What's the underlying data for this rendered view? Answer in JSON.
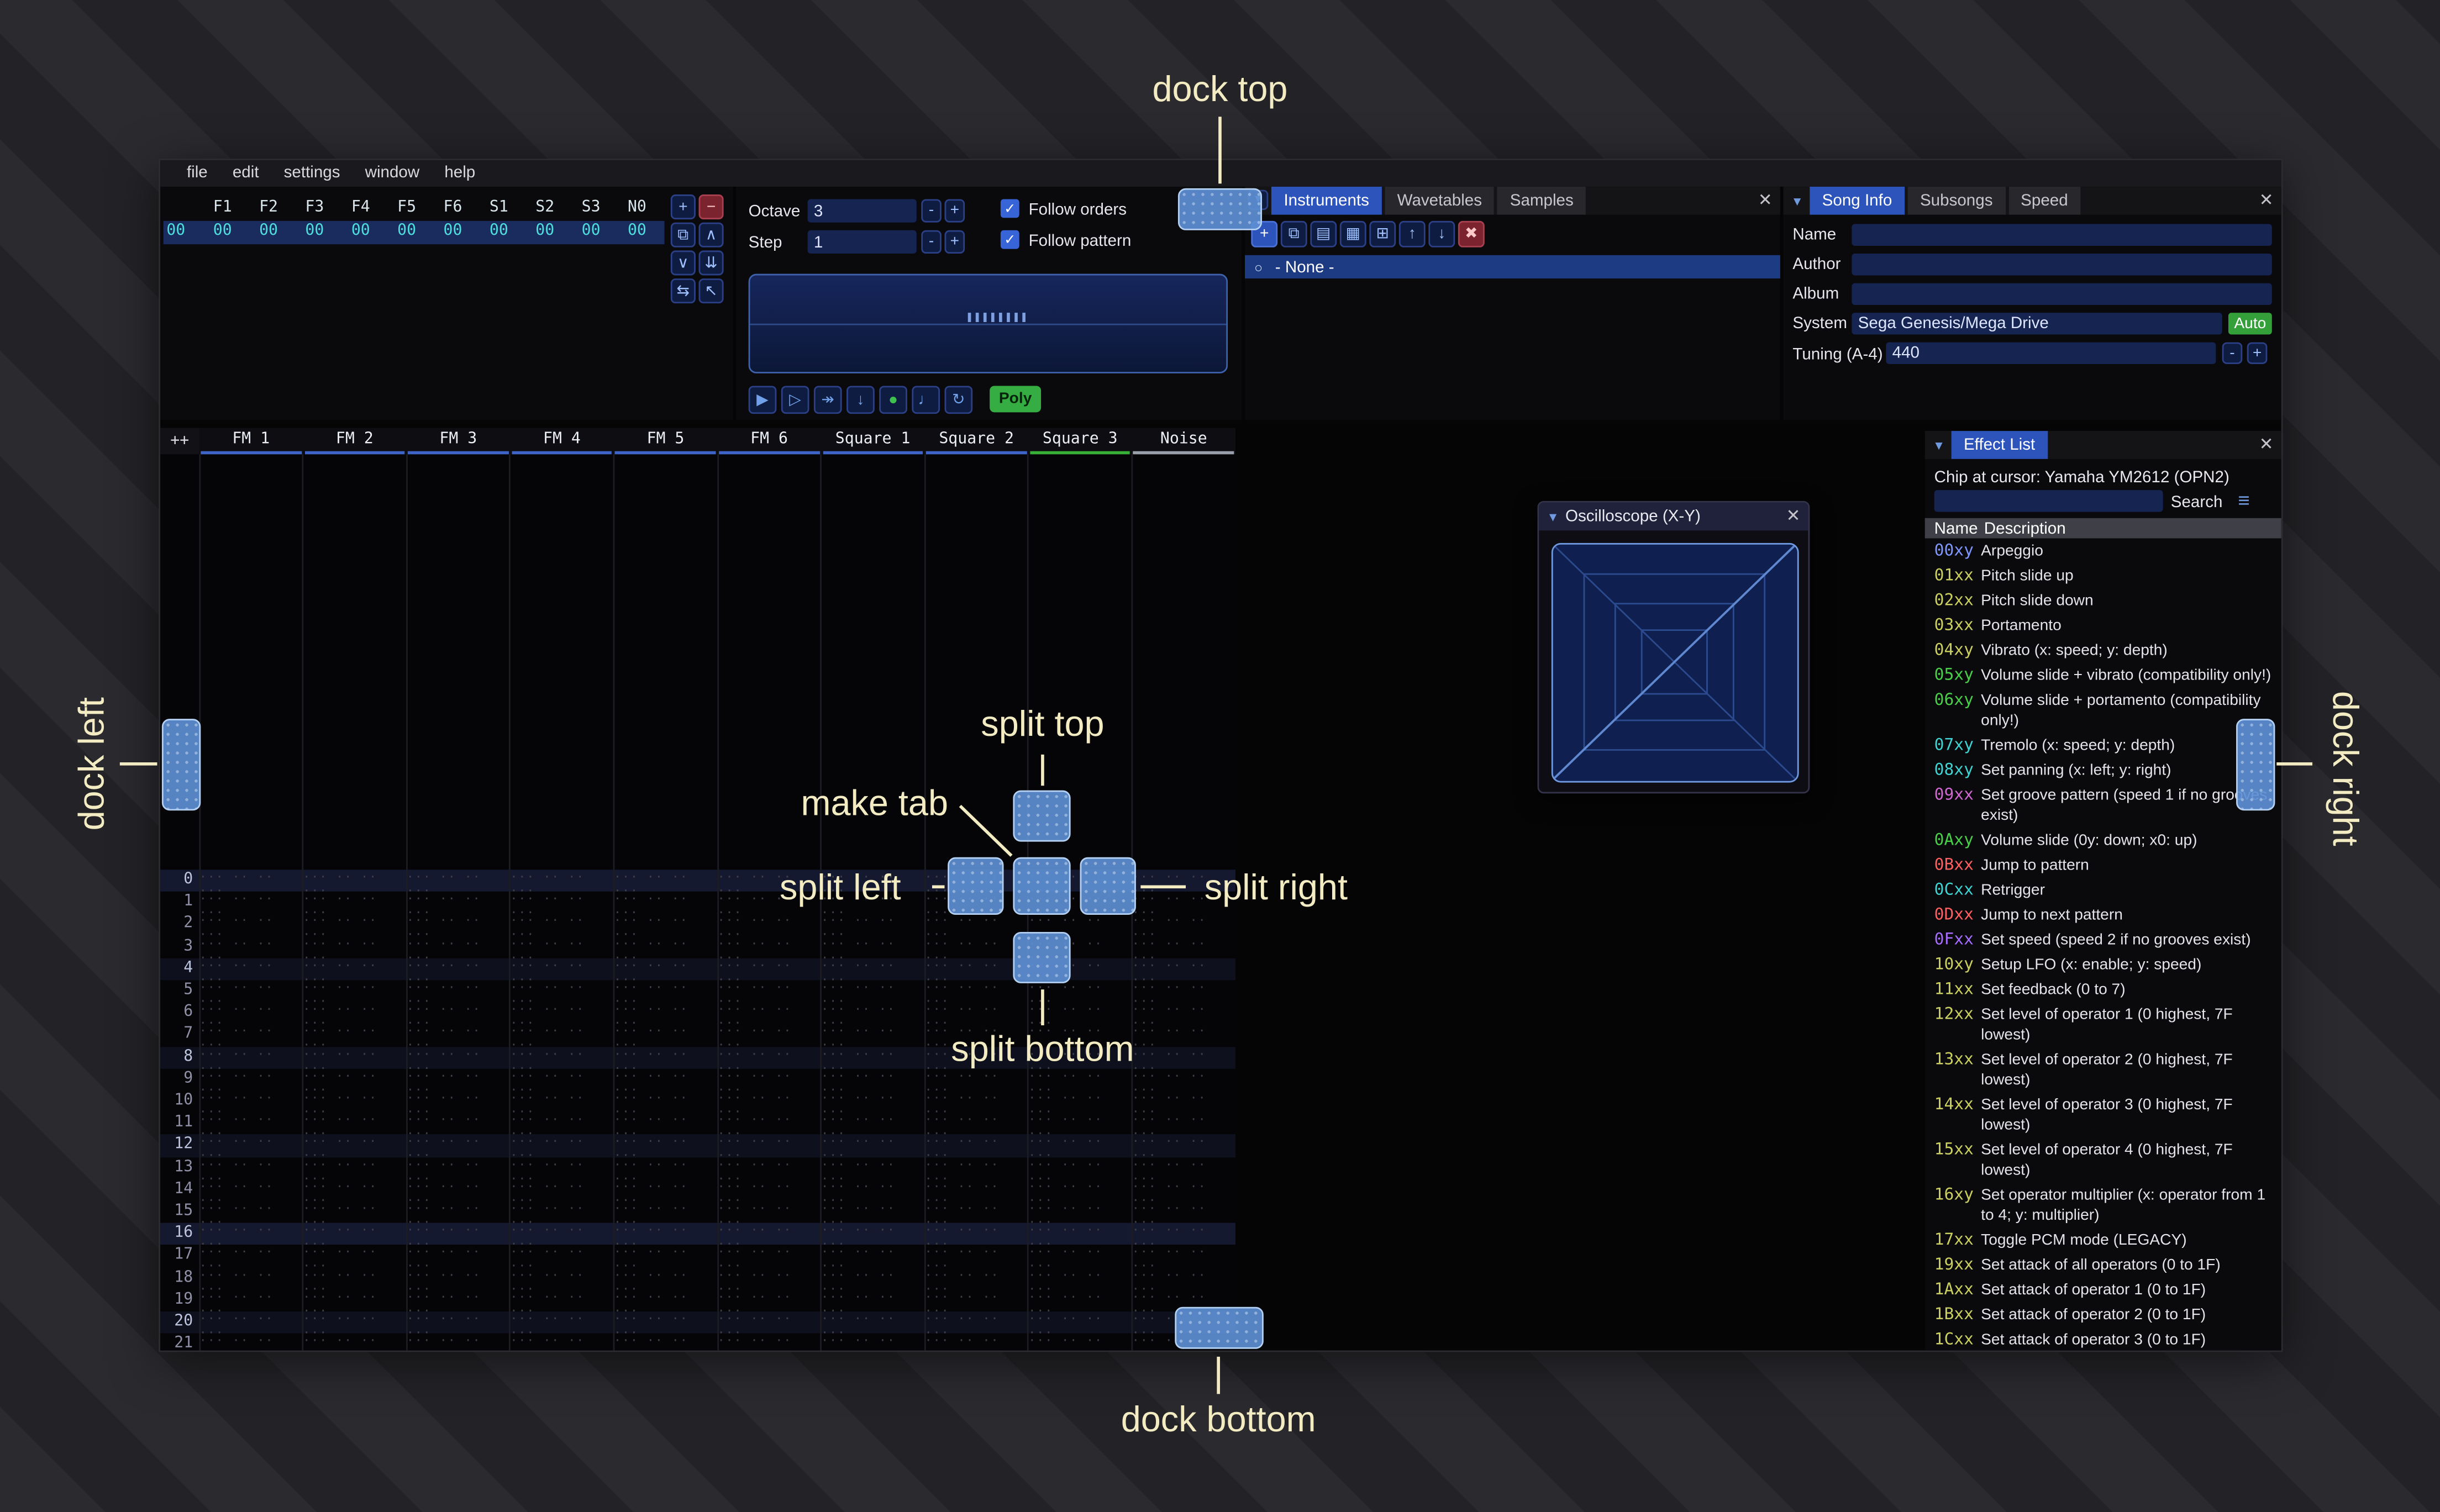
{
  "icons": {
    "close": "✕",
    "collapse": "▼",
    "hamburger": "≡",
    "radio": "○",
    "check": "✓",
    "dropdown": "▼"
  },
  "annotations": {
    "color": "#f3ecc2",
    "dock_top": "dock top",
    "dock_left": "dock left",
    "dock_right": "dock right",
    "dock_bottom": "dock bottom",
    "split_top": "split top",
    "split_left": "split left",
    "split_right": "split right",
    "split_bottom": "split bottom",
    "make_tab": "make tab"
  },
  "menu": {
    "items": [
      "file",
      "edit",
      "settings",
      "window",
      "help"
    ]
  },
  "orders": {
    "channels": [
      "F1",
      "F2",
      "F3",
      "F4",
      "F5",
      "F6",
      "S1",
      "S2",
      "S3",
      "N0"
    ],
    "row_index": "00",
    "values": [
      "00",
      "00",
      "00",
      "00",
      "00",
      "00",
      "00",
      "00",
      "00",
      "00"
    ],
    "buttons": [
      {
        "name": "add-order-button",
        "glyph": "+"
      },
      {
        "name": "remove-order-button",
        "glyph": "−",
        "danger": true
      },
      {
        "name": "duplicate-order-button",
        "glyph": "⧉"
      },
      {
        "name": "move-order-up-button",
        "glyph": "∧"
      },
      {
        "name": "move-order-down-button",
        "glyph": "∨"
      },
      {
        "name": "duplicate-order-end-button",
        "glyph": "⇊"
      },
      {
        "name": "order-change-mode-button",
        "glyph": "⇆"
      },
      {
        "name": "order-edit-mode-button",
        "glyph": "↖"
      }
    ]
  },
  "controls": {
    "octave_label": "Octave",
    "octave_value": "3",
    "step_label": "Step",
    "step_value": "1",
    "minus": "-",
    "plus": "+",
    "follow_orders": "Follow orders",
    "follow_pattern": "Follow pattern",
    "play_buttons": [
      {
        "name": "play-button",
        "glyph": "▶"
      },
      {
        "name": "play-from-start-button",
        "glyph": "▷"
      },
      {
        "name": "step-play-button",
        "glyph": "↠"
      },
      {
        "name": "move-down-button",
        "glyph": "↓"
      },
      {
        "name": "edit-toggle-button",
        "glyph": "●",
        "color": "#3dc24e"
      },
      {
        "name": "metronome-button",
        "glyph": "♩"
      },
      {
        "name": "repeat-pattern-button",
        "glyph": "↻"
      }
    ],
    "poly_label": "Poly"
  },
  "instruments": {
    "tabs": [
      {
        "label": "Instruments",
        "active": true
      },
      {
        "label": "Wavetables",
        "active": false
      },
      {
        "label": "Samples",
        "active": false
      }
    ],
    "toolbar": [
      {
        "name": "add-instrument-button",
        "glyph": "+",
        "accent": true
      },
      {
        "name": "duplicate-instrument-button",
        "glyph": "⧉"
      },
      {
        "name": "open-instrument-button",
        "glyph": "▤"
      },
      {
        "name": "save-instrument-button",
        "glyph": "▦"
      },
      {
        "name": "instrument-folders-button",
        "glyph": "⊞"
      },
      {
        "name": "move-instrument-up-button",
        "glyph": "↑"
      },
      {
        "name": "move-instrument-down-button",
        "glyph": "↓"
      },
      {
        "name": "delete-instrument-button",
        "glyph": "✖",
        "danger": true
      }
    ],
    "list": [
      {
        "label": "- None -"
      }
    ]
  },
  "song_info": {
    "tabs": [
      {
        "label": "Song Info",
        "active": true
      },
      {
        "label": "Subsongs",
        "active": false
      },
      {
        "label": "Speed",
        "active": false
      }
    ],
    "fields": [
      {
        "label": "Name",
        "value": ""
      },
      {
        "label": "Author",
        "value": ""
      },
      {
        "label": "Album",
        "value": ""
      },
      {
        "label": "System",
        "value": "Sega Genesis/Mega Drive",
        "button": "Auto",
        "button_color": "#34a03a"
      }
    ],
    "tuning_label": "Tuning (A-4)",
    "tuning_value": "440",
    "minus": "-",
    "plus": "+"
  },
  "pattern": {
    "expand_button": "++",
    "channels": [
      {
        "name": "FM 1",
        "color": "#3f64c8"
      },
      {
        "name": "FM 2",
        "color": "#3f64c8"
      },
      {
        "name": "FM 3",
        "color": "#3f64c8"
      },
      {
        "name": "FM 4",
        "color": "#3f64c8"
      },
      {
        "name": "FM 5",
        "color": "#3f64c8"
      },
      {
        "name": "FM 6",
        "color": "#3f64c8"
      },
      {
        "name": "Square 1",
        "color": "#3f64c8"
      },
      {
        "name": "Square 2",
        "color": "#3f64c8"
      },
      {
        "name": "Square 3",
        "color": "#37b037"
      },
      {
        "name": "Noise",
        "color": "#9aa0ab"
      }
    ],
    "row_count": 22,
    "empty_cell": "... .. .. ...",
    "strong_rows": [
      0,
      16
    ]
  },
  "oscilloscope": {
    "title": "Oscilloscope (X-Y)"
  },
  "effect_list": {
    "title": "Effect List",
    "chip_label": "Chip at cursor: Yamaha YM2612 (OPN2)",
    "search_label": "Search",
    "search_value": "",
    "columns": [
      "Name",
      "Description"
    ],
    "effects": [
      {
        "code": "00xy",
        "color": "#8096ff",
        "desc": "Arpeggio"
      },
      {
        "code": "01xx",
        "color": "#ccd05e",
        "desc": "Pitch slide up"
      },
      {
        "code": "02xx",
        "color": "#ccd05e",
        "desc": "Pitch slide down"
      },
      {
        "code": "03xx",
        "color": "#ccd05e",
        "desc": "Portamento"
      },
      {
        "code": "04xy",
        "color": "#ccd05e",
        "desc": "Vibrato (x: speed; y: depth)"
      },
      {
        "code": "05xy",
        "color": "#49d049",
        "desc": "Volume slide + vibrato (compatibility only!)"
      },
      {
        "code": "06xy",
        "color": "#49d049",
        "desc": "Volume slide + portamento (compatibility only!)"
      },
      {
        "code": "07xy",
        "color": "#3fd4d4",
        "desc": "Tremolo (x: speed; y: depth)"
      },
      {
        "code": "08xy",
        "color": "#3fd4d4",
        "desc": "Set panning (x: left; y: right)"
      },
      {
        "code": "09xx",
        "color": "#d066d0",
        "desc": "Set groove pattern (speed 1 if no grooves exist)"
      },
      {
        "code": "0Axy",
        "color": "#49d049",
        "desc": "Volume slide (0y: down; x0: up)"
      },
      {
        "code": "0Bxx",
        "color": "#ff5f5f",
        "desc": "Jump to pattern"
      },
      {
        "code": "0Cxx",
        "color": "#3fd4d4",
        "desc": "Retrigger"
      },
      {
        "code": "0Dxx",
        "color": "#ff5f5f",
        "desc": "Jump to next pattern"
      },
      {
        "code": "0Fxx",
        "color": "#a66bff",
        "desc": "Set speed (speed 2 if no grooves exist)"
      },
      {
        "code": "10xy",
        "color": "#ccd05e",
        "desc": "Setup LFO (x: enable; y: speed)"
      },
      {
        "code": "11xx",
        "color": "#ccd05e",
        "desc": "Set feedback (0 to 7)"
      },
      {
        "code": "12xx",
        "color": "#ccd05e",
        "desc": "Set level of operator 1 (0 highest, 7F lowest)"
      },
      {
        "code": "13xx",
        "color": "#ccd05e",
        "desc": "Set level of operator 2 (0 highest, 7F lowest)"
      },
      {
        "code": "14xx",
        "color": "#ccd05e",
        "desc": "Set level of operator 3 (0 highest, 7F lowest)"
      },
      {
        "code": "15xx",
        "color": "#ccd05e",
        "desc": "Set level of operator 4 (0 highest, 7F lowest)"
      },
      {
        "code": "16xy",
        "color": "#ccd05e",
        "desc": "Set operator multiplier (x: operator from 1 to 4; y: multiplier)"
      },
      {
        "code": "17xx",
        "color": "#ccd05e",
        "desc": "Toggle PCM mode (LEGACY)"
      },
      {
        "code": "19xx",
        "color": "#ccd05e",
        "desc": "Set attack of all operators (0 to 1F)"
      },
      {
        "code": "1Axx",
        "color": "#ccd05e",
        "desc": "Set attack of operator 1 (0 to 1F)"
      },
      {
        "code": "1Bxx",
        "color": "#ccd05e",
        "desc": "Set attack of operator 2 (0 to 1F)"
      },
      {
        "code": "1Cxx",
        "color": "#ccd05e",
        "desc": "Set attack of operator 3 (0 to 1F)"
      }
    ]
  }
}
